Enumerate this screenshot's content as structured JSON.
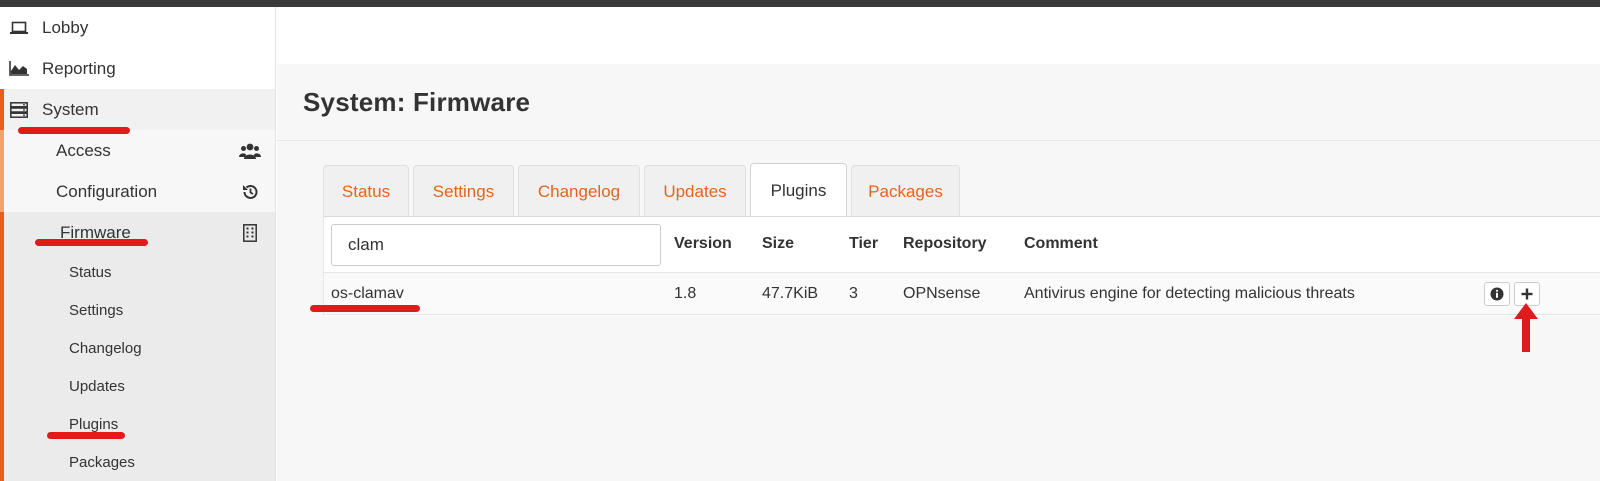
{
  "sidebar": {
    "lobby": "Lobby",
    "reporting": "Reporting",
    "system": "System",
    "access": "Access",
    "configuration": "Configuration",
    "firmware": "Firmware",
    "firmware_items": [
      "Status",
      "Settings",
      "Changelog",
      "Updates",
      "Plugins",
      "Packages"
    ]
  },
  "page": {
    "title": "System: Firmware"
  },
  "tabs": [
    "Status",
    "Settings",
    "Changelog",
    "Updates",
    "Plugins",
    "Packages"
  ],
  "active_tab": "Plugins",
  "search": {
    "value": "clam"
  },
  "table": {
    "headers": [
      "Version",
      "Size",
      "Tier",
      "Repository",
      "Comment"
    ],
    "rows": [
      {
        "name": "os-clamav",
        "version": "1.8",
        "size": "47.7KiB",
        "tier": "3",
        "repository": "OPNsense",
        "comment": "Antivirus engine for detecting malicious threats"
      }
    ]
  },
  "colors": {
    "accent": "#e95d1d",
    "tab_text": "#e0661c",
    "annotation": "#e01b1b"
  },
  "icons": [
    "laptop-icon",
    "area-chart-icon",
    "server-icon",
    "users-icon",
    "history-icon",
    "building-icon",
    "info-icon",
    "plus-icon",
    "arrow-up-icon"
  ]
}
